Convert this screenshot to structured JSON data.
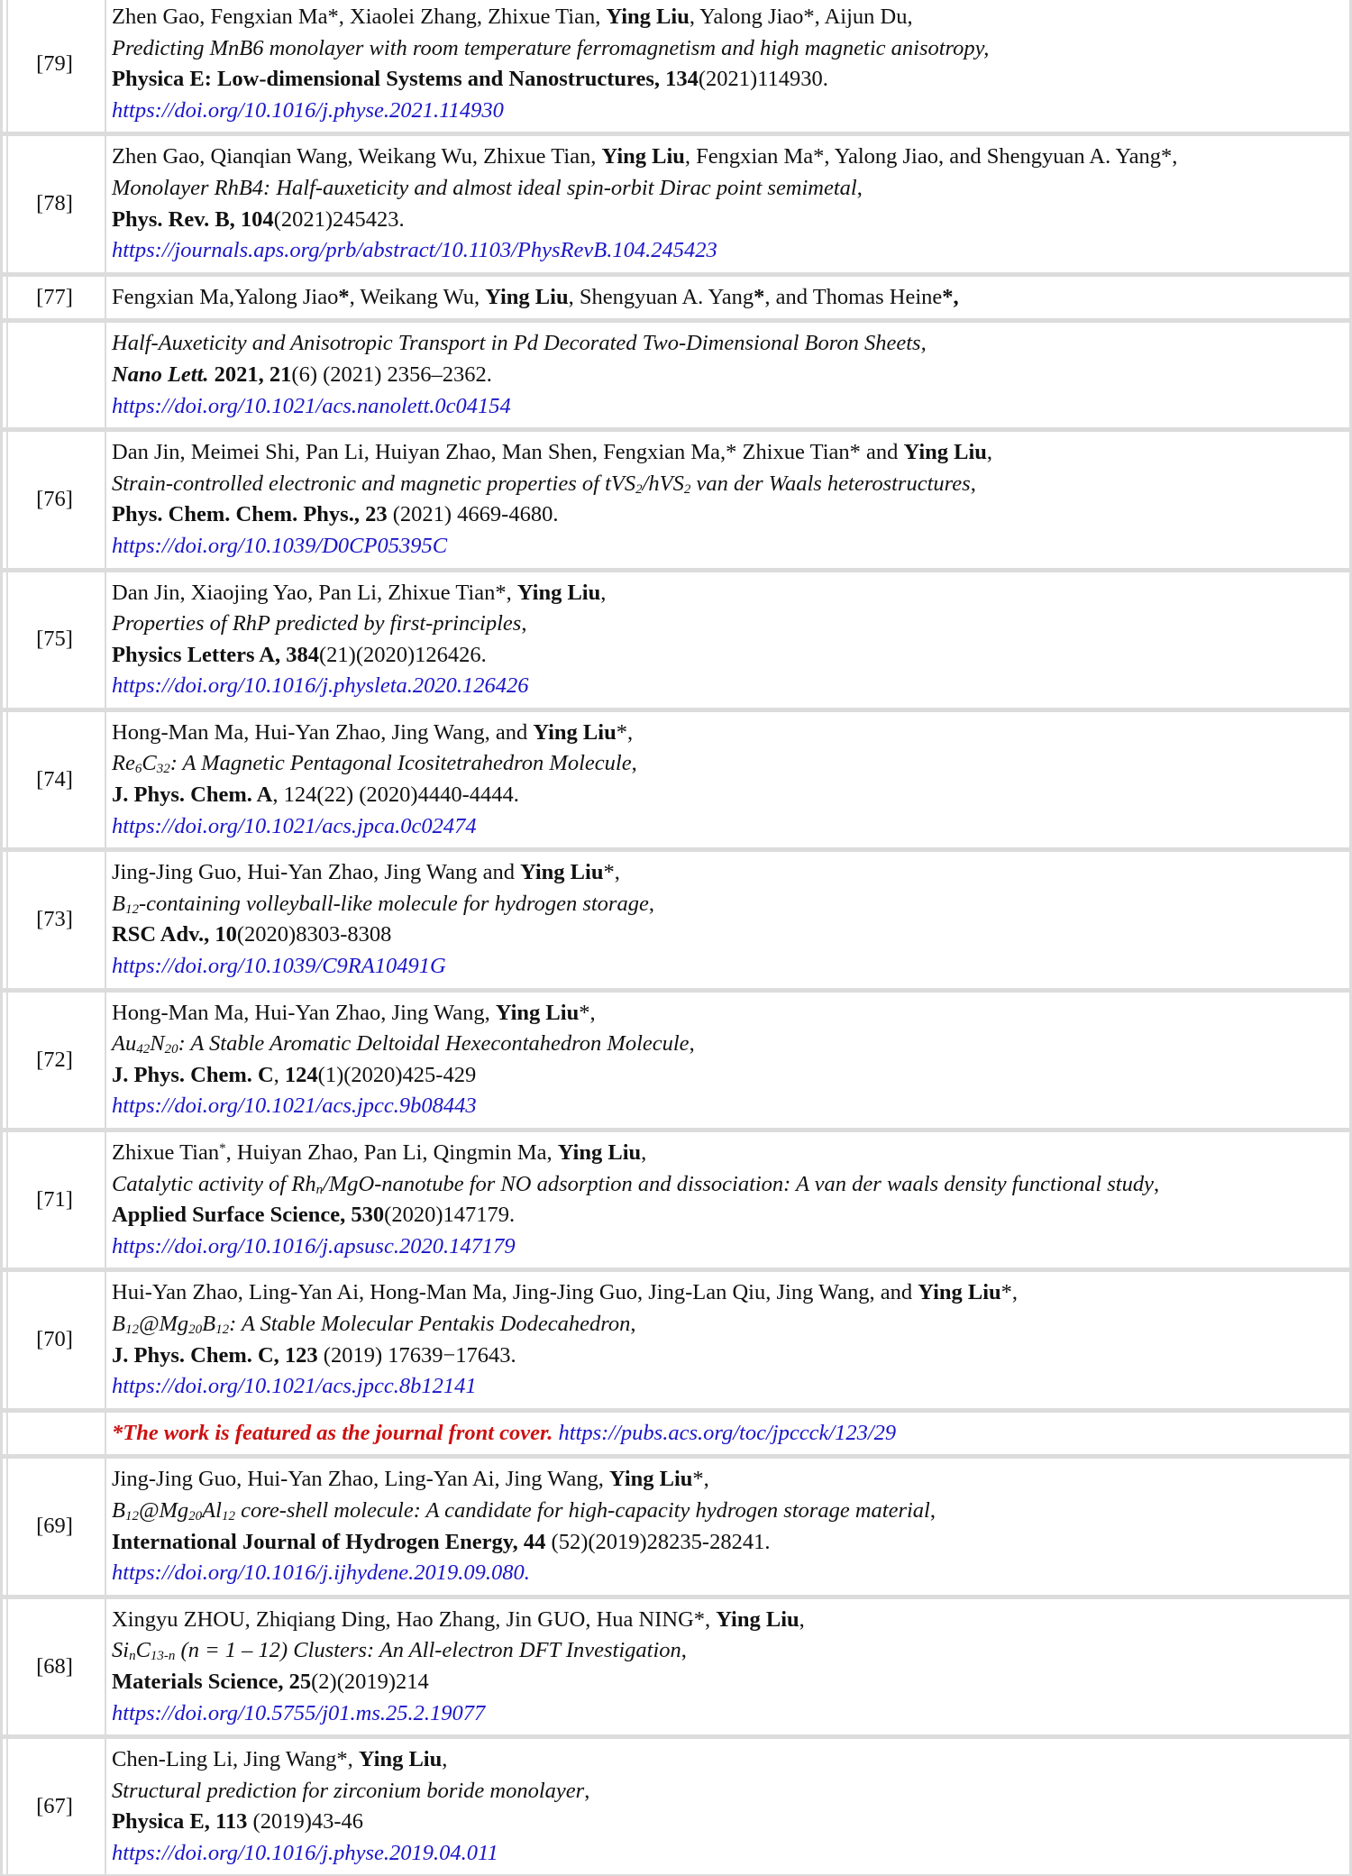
{
  "entries": [
    {
      "num": "[79]",
      "authors": [
        {
          "t": "Zhen Gao, Fengxian Ma*, Xiaolei Zhang, Zhixue Tian, "
        },
        {
          "t": "Ying Liu",
          "b": true
        },
        {
          "t": ", Yalong Jiao*, Aijun Du,"
        }
      ],
      "title": [
        {
          "t": "Predicting MnB6 monolayer with room temperature ferromagnetism and high magnetic anisotropy,"
        }
      ],
      "journal": [
        {
          "t": "Physica E: Low-dimensional Systems and Nanostructures, 134",
          "b": true
        },
        {
          "t": "(2021)114930."
        }
      ],
      "link": "https://doi.org/10.1016/j.physe.2021.114930"
    },
    {
      "num": "[78]",
      "authors": [
        {
          "t": "Zhen Gao, Qianqian Wang, Weikang Wu, Zhixue Tian, "
        },
        {
          "t": "Ying Liu",
          "b": true
        },
        {
          "t": ", Fengxian Ma*, Yalong Jiao, and Shengyuan A. Yang*,"
        }
      ],
      "title": [
        {
          "t": "Monolayer RhB4: Half-auxeticity and almost ideal spin-orbit Dirac point semimetal"
        },
        {
          "t": ",",
          "n": true
        }
      ],
      "journal": [
        {
          "t": "Phys. Rev. B, 104",
          "b": true
        },
        {
          "t": "(2021)245423."
        }
      ],
      "link": "https://journals.aps.org/prb/abstract/10.1103/PhysRevB.104.245423"
    },
    {
      "num": "[77]",
      "authors": [
        {
          "t": "Fengxian Ma,Yalong Jiao"
        },
        {
          "t": "*",
          "b": true
        },
        {
          "t": ", Weikang Wu, "
        },
        {
          "t": "Ying Liu",
          "b": true
        },
        {
          "t": ", Shengyuan A. Yang"
        },
        {
          "t": "*",
          "b": true
        },
        {
          "t": ", and Thomas Heine"
        },
        {
          "t": "*,",
          "b": true
        }
      ],
      "title": [],
      "journal": [],
      "link": ""
    },
    {
      "num": "",
      "authors": [],
      "title": [
        {
          "t": "Half-Auxeticity and Anisotropic Transport in Pd Decorated Two-Dimensional Boron Sheets,"
        }
      ],
      "journal": [
        {
          "t": "Nano Lett.",
          "b": true,
          "i": true
        },
        {
          "t": " 2021, 21",
          "b": true
        },
        {
          "t": "(6) (2021) 2356–2362."
        }
      ],
      "link": "https://doi.org/10.1021/acs.nanolett.0c04154"
    },
    {
      "num": "[76]",
      "authors": [
        {
          "t": "Dan Jin, Meimei Shi, Pan Li, Huiyan Zhao, Man Shen, Fengxian Ma,* Zhixue Tian* and "
        },
        {
          "t": "Ying Liu",
          "b": true
        },
        {
          "t": ","
        }
      ],
      "title": [
        {
          "t": "Strain-controlled electronic and magnetic properties of tVS"
        },
        {
          "t": "2",
          "sub": true
        },
        {
          "t": "/hVS"
        },
        {
          "t": "2",
          "sub": true
        },
        {
          "t": " van der Waals heterostructures"
        },
        {
          "t": ",",
          "n": true
        }
      ],
      "journal": [
        {
          "t": "Phys. Chem. Chem. Phys., 23",
          "b": true
        },
        {
          "t": " (2021) 4669-4680."
        }
      ],
      "link": "https://doi.org/10.1039/D0CP05395C"
    },
    {
      "num": "[75]",
      "authors": [
        {
          "t": "Dan Jin, Xiaojing Yao, Pan Li, Zhixue Tian*, "
        },
        {
          "t": "Ying Liu",
          "b": true
        },
        {
          "t": ","
        }
      ],
      "title": [
        {
          "t": "Properties of RhP predicted by first-principles"
        },
        {
          "t": ",",
          "n": true
        }
      ],
      "journal": [
        {
          "t": "Physics Letters A, 384",
          "b": true
        },
        {
          "t": "(21)(2020)126426."
        }
      ],
      "link": "https://doi.org/10.1016/j.physleta.2020.126426"
    },
    {
      "num": "[74]",
      "authors": [
        {
          "t": "Hong-Man Ma, Hui-Yan Zhao, Jing Wang, and "
        },
        {
          "t": "Ying Liu",
          "b": true
        },
        {
          "t": "*,"
        }
      ],
      "title": [
        {
          "t": "Re"
        },
        {
          "t": "6",
          "sub": true
        },
        {
          "t": "C"
        },
        {
          "t": "32",
          "sub": true
        },
        {
          "t": ": A Magnetic Pentagonal Icositetrahedron Molecule"
        },
        {
          "t": ",",
          "n": true
        }
      ],
      "journal": [
        {
          "t": "J. Phys. Chem. A",
          "b": true
        },
        {
          "t": ", 124(22) (2020)4440-4444."
        }
      ],
      "link": "https://doi.org/10.1021/acs.jpca.0c02474"
    },
    {
      "num": "[73]",
      "authors": [
        {
          "t": "Jing-Jing Guo, Hui-Yan Zhao, Jing Wang and "
        },
        {
          "t": "Ying Liu",
          "b": true
        },
        {
          "t": "*,"
        }
      ],
      "title": [
        {
          "t": "B"
        },
        {
          "t": "12",
          "sub": true
        },
        {
          "t": "-containing volleyball-like molecule for hydrogen storage"
        },
        {
          "t": ",",
          "n": true
        }
      ],
      "journal": [
        {
          "t": "RSC Adv., 10",
          "b": true
        },
        {
          "t": "(2020)8303-8308"
        }
      ],
      "link": "https://doi.org/10.1039/C9RA10491G"
    },
    {
      "num": "[72]",
      "authors": [
        {
          "t": "Hong-Man Ma, Hui-Yan Zhao, Jing Wang, "
        },
        {
          "t": "Ying Liu",
          "b": true
        },
        {
          "t": "*,"
        }
      ],
      "title": [
        {
          "t": "Au"
        },
        {
          "t": "42",
          "sub": true
        },
        {
          "t": "N"
        },
        {
          "t": "20",
          "sub": true
        },
        {
          "t": ": A Stable Aromatic Deltoidal Hexecontahedron Molecule"
        },
        {
          "t": ",",
          "n": true
        }
      ],
      "journal": [
        {
          "t": "J. Phys. Chem. C",
          "b": true
        },
        {
          "t": ", "
        },
        {
          "t": "124",
          "b": true
        },
        {
          "t": "(1)(2020)425-429"
        }
      ],
      "link": "https://doi.org/10.1021/acs.jpcc.9b08443"
    },
    {
      "num": "[71]",
      "authors": [
        {
          "t": "Zhixue Tian"
        },
        {
          "t": "*",
          "sup": true
        },
        {
          "t": ", Huiyan Zhao, Pan Li, Qingmin Ma, "
        },
        {
          "t": "Ying Liu",
          "b": true
        },
        {
          "t": ","
        }
      ],
      "title": [
        {
          "t": "Catalytic activity of Rh"
        },
        {
          "t": "n",
          "sub": true
        },
        {
          "t": "/MgO-nanotube for NO adsorption and dissociation: A van der waals density functional study"
        },
        {
          "t": ",",
          "n": true
        }
      ],
      "journal": [
        {
          "t": "Applied Surface Science, 530",
          "b": true
        },
        {
          "t": "(2020)147179."
        }
      ],
      "link": "https://doi.org/10.1016/j.apsusc.2020.147179"
    },
    {
      "num": "[70]",
      "authors": [
        {
          "t": "Hui-Yan Zhao, Ling-Yan Ai, Hong-Man Ma, Jing-Jing Guo, Jing-Lan Qiu, Jing Wang, and "
        },
        {
          "t": "Ying Liu",
          "b": true
        },
        {
          "t": "*,"
        }
      ],
      "title": [
        {
          "t": "B"
        },
        {
          "t": "12",
          "sub": true
        },
        {
          "t": "@Mg"
        },
        {
          "t": "20",
          "sub": true
        },
        {
          "t": "B"
        },
        {
          "t": "12",
          "sub": true
        },
        {
          "t": ": A Stable Molecular Pentakis Dodecahedron"
        },
        {
          "t": ",",
          "n": true
        }
      ],
      "journal": [
        {
          "t": "J. Phys. Chem. C, 123",
          "b": true
        },
        {
          "t": " (2019) 17639−17643."
        }
      ],
      "link": "https://doi.org/10.1021/acs.jpcc.8b12141"
    },
    {
      "num": "",
      "note": "*The work is featured as the journal front cover.",
      "note_link": "https://pubs.acs.org/toc/jpccck/123/29",
      "authors": [],
      "title": [],
      "journal": [],
      "link": ""
    },
    {
      "num": "[69]",
      "authors": [
        {
          "t": "Jing-Jing Guo, Hui-Yan Zhao, Ling-Yan Ai, Jing Wang, "
        },
        {
          "t": "Ying Liu",
          "b": true
        },
        {
          "t": "*,"
        }
      ],
      "title": [
        {
          "t": "B"
        },
        {
          "t": "12",
          "sub": true
        },
        {
          "t": "@Mg"
        },
        {
          "t": "20",
          "sub": true
        },
        {
          "t": "Al"
        },
        {
          "t": "12",
          "sub": true
        },
        {
          "t": " core-shell molecule: A candidate for high-capacity hydrogen storage material"
        },
        {
          "t": ",",
          "n": true
        }
      ],
      "journal": [
        {
          "t": "International Journal of Hydrogen Energy, 44",
          "b": true
        },
        {
          "t": " (52)(2019)28235-28241."
        }
      ],
      "link": "https://doi.org/10.1016/j.ijhydene.2019.09.080."
    },
    {
      "num": "[68]",
      "authors": [
        {
          "t": "Xingyu ZHOU, Zhiqiang Ding, Hao Zhang, Jin GUO, Hua NING*, "
        },
        {
          "t": "Ying Liu",
          "b": true
        },
        {
          "t": ","
        }
      ],
      "title": [
        {
          "t": "Si"
        },
        {
          "t": "n",
          "sub": true
        },
        {
          "t": "C"
        },
        {
          "t": "13-n",
          "sub": true
        },
        {
          "t": " (n = 1 – 12) Clusters: An All-electron DFT Investigation"
        },
        {
          "t": ",",
          "n": true
        }
      ],
      "journal": [
        {
          "t": "Materials Science, 25",
          "b": true
        },
        {
          "t": "(2)(2019)214"
        }
      ],
      "link": "https://doi.org/10.5755/j01.ms.25.2.19077"
    },
    {
      "num": "[67]",
      "authors": [
        {
          "t": "Chen-Ling Li, Jing Wang*, "
        },
        {
          "t": "Ying Liu",
          "b": true
        },
        {
          "t": ","
        }
      ],
      "title": [
        {
          "t": "Structural prediction for zirconium boride monolayer"
        },
        {
          "t": ",",
          "n": true
        }
      ],
      "journal": [
        {
          "t": "Physica E, 113",
          "b": true
        },
        {
          "t": " (2019)43-46"
        }
      ],
      "link": "https://doi.org/10.1016/j.physe.2019.04.011"
    }
  ]
}
